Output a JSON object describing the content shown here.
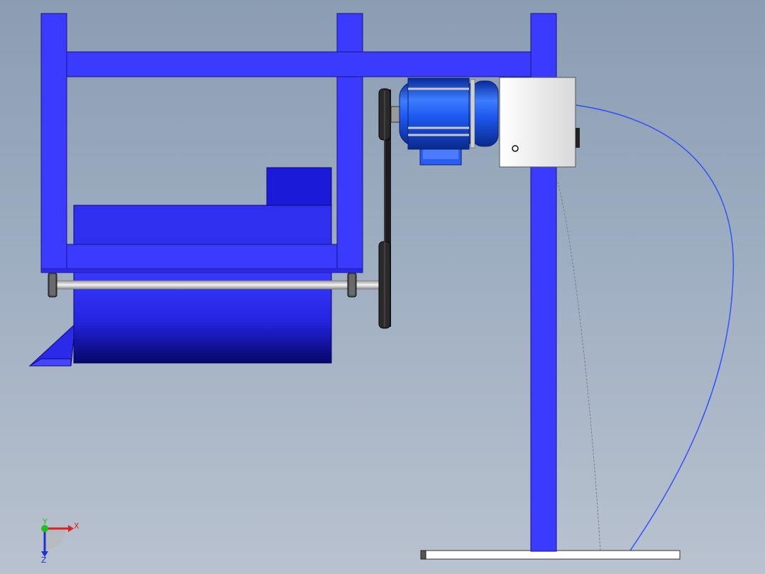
{
  "scene": {
    "frame_color": "#3b3bff",
    "frame_edge_color": "#15157a",
    "motor_color": "#1e5cff",
    "drum_color": "#2a2af0",
    "belt_color": "#1c1c1c",
    "housing_color": "#f2f2f2",
    "cable_color": "#2b4cff"
  },
  "triad": {
    "x_label": "X",
    "y_label": "Y",
    "z_label": "Z",
    "x_color": "#e02020",
    "y_color": "#20c020",
    "z_color": "#2030d0"
  }
}
